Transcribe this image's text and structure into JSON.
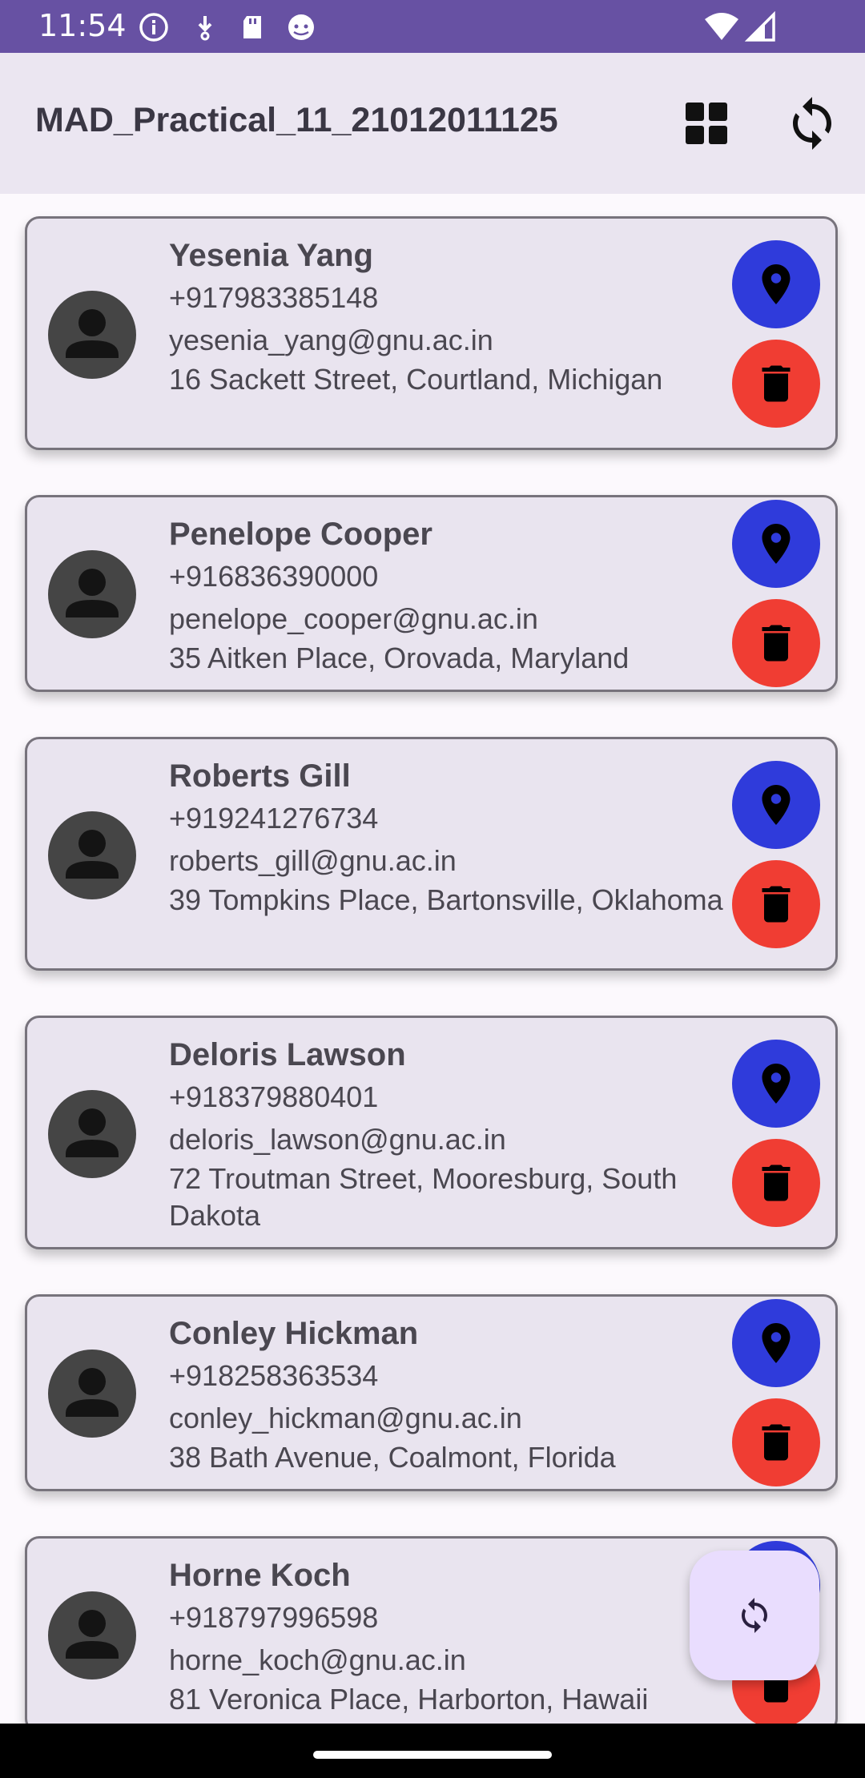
{
  "status_bar": {
    "time": "11:54",
    "left_icons": [
      "info-icon",
      "download-icon",
      "sd-card-icon",
      "android-debug-icon"
    ],
    "right_icons": [
      "wifi-icon",
      "signal-icon"
    ]
  },
  "app_bar": {
    "title": "MAD_Practical_11_21012011125",
    "actions": [
      "grid-view-icon",
      "refresh-icon"
    ]
  },
  "contacts": [
    {
      "name": "Yesenia Yang",
      "phone": "+917983385148",
      "email": "yesenia_yang@gnu.ac.in",
      "address": "16 Sackett Street, Courtland, Michigan"
    },
    {
      "name": "Penelope Cooper",
      "phone": "+916836390000",
      "email": "penelope_cooper@gnu.ac.in",
      "address": "35 Aitken Place, Orovada, Maryland"
    },
    {
      "name": "Roberts Gill",
      "phone": "+919241276734",
      "email": "roberts_gill@gnu.ac.in",
      "address": "39 Tompkins Place, Bartonsville, Oklahoma"
    },
    {
      "name": "Deloris Lawson",
      "phone": "+918379880401",
      "email": "deloris_lawson@gnu.ac.in",
      "address": "72 Troutman Street, Mooresburg, South Dakota"
    },
    {
      "name": "Conley Hickman",
      "phone": "+918258363534",
      "email": "conley_hickman@gnu.ac.in",
      "address": "38 Bath Avenue, Coalmont, Florida"
    },
    {
      "name": "Horne Koch",
      "phone": "+918797996598",
      "email": "horne_koch@gnu.ac.in",
      "address": "81 Veronica Place, Harborton, Hawaii"
    }
  ],
  "item_icons": {
    "avatar": "person-icon",
    "location": "location-pin-icon",
    "delete": "trash-icon"
  },
  "fab": {
    "icon": "refresh-icon"
  },
  "colors": {
    "status_bar": "#6751a3",
    "app_bar": "#ebe6f1",
    "card": "#e9e4ef",
    "location_button": "#2f3bdb",
    "delete_button": "#f03d33",
    "fab": "#e9ddfe"
  }
}
